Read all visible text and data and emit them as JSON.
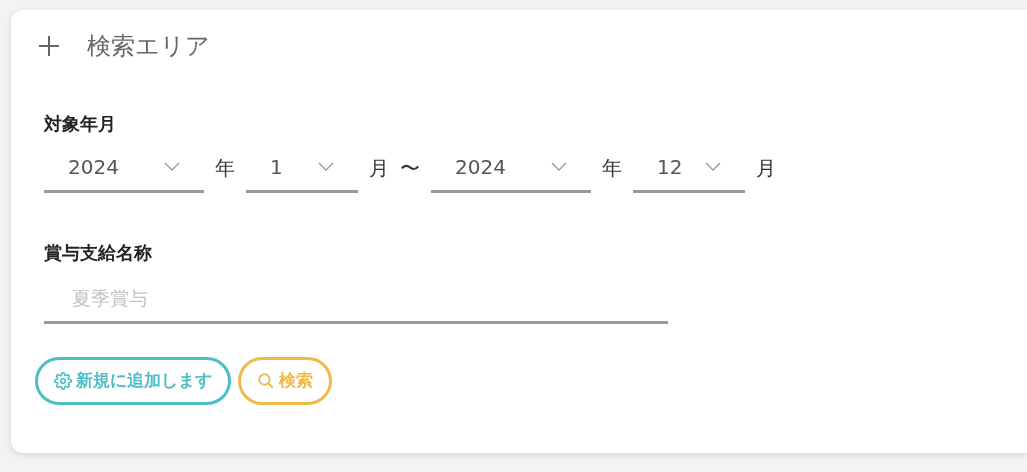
{
  "panel": {
    "title": "検索エリア",
    "expanded": false
  },
  "period": {
    "label": "対象年月",
    "parts": [
      {
        "kind": "select",
        "value": "2024"
      },
      {
        "kind": "unit",
        "text": "年"
      },
      {
        "kind": "select",
        "value": "1"
      },
      {
        "kind": "unit",
        "text": "月"
      },
      {
        "kind": "unit",
        "text": "〜"
      },
      {
        "kind": "select",
        "value": "2024"
      },
      {
        "kind": "unit",
        "text": "年"
      },
      {
        "kind": "select",
        "value": "12"
      },
      {
        "kind": "unit",
        "text": "月"
      }
    ]
  },
  "bonus_name": {
    "label": "賞与支給名称",
    "placeholder": "夏季賞与"
  },
  "buttons": [
    {
      "kind": "add",
      "label": "新規に追加します"
    },
    {
      "kind": "search",
      "label": "検索"
    }
  ]
}
